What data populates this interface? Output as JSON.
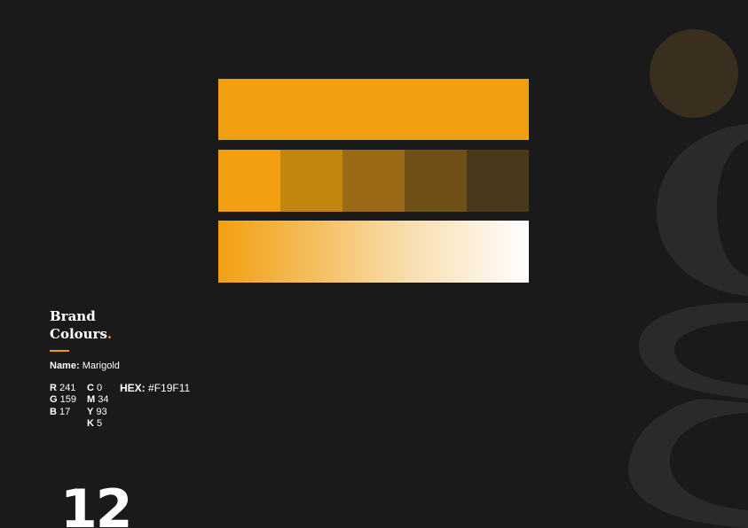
{
  "section": {
    "title_line1": "Brand",
    "title_line2": "Colours",
    "title_dot": "."
  },
  "color": {
    "name_label": "Name:",
    "name_value": "Marigold",
    "rgb": [
      {
        "label": "R",
        "value": "241"
      },
      {
        "label": "G",
        "value": "159"
      },
      {
        "label": "B",
        "value": "17"
      }
    ],
    "cmyk": [
      {
        "label": "C",
        "value": "0"
      },
      {
        "label": "M",
        "value": "34"
      },
      {
        "label": "Y",
        "value": "93"
      },
      {
        "label": "K",
        "value": "5"
      }
    ],
    "hex_label": "HEX:",
    "hex_value": "#F19F11"
  },
  "swatches": {
    "main": "#F19F11",
    "shades": [
      "#f19f11",
      "#c4850f",
      "#9b6a17",
      "#705018",
      "#48391b"
    ],
    "gradient": [
      "#F19F11",
      "#ffffff"
    ]
  },
  "colors": {
    "background": "#1a1a1a",
    "accent": "#F19F11",
    "decor_circle": "#3a2f1e",
    "decor_glyph": "#2a2a2a"
  },
  "page_number": "12"
}
